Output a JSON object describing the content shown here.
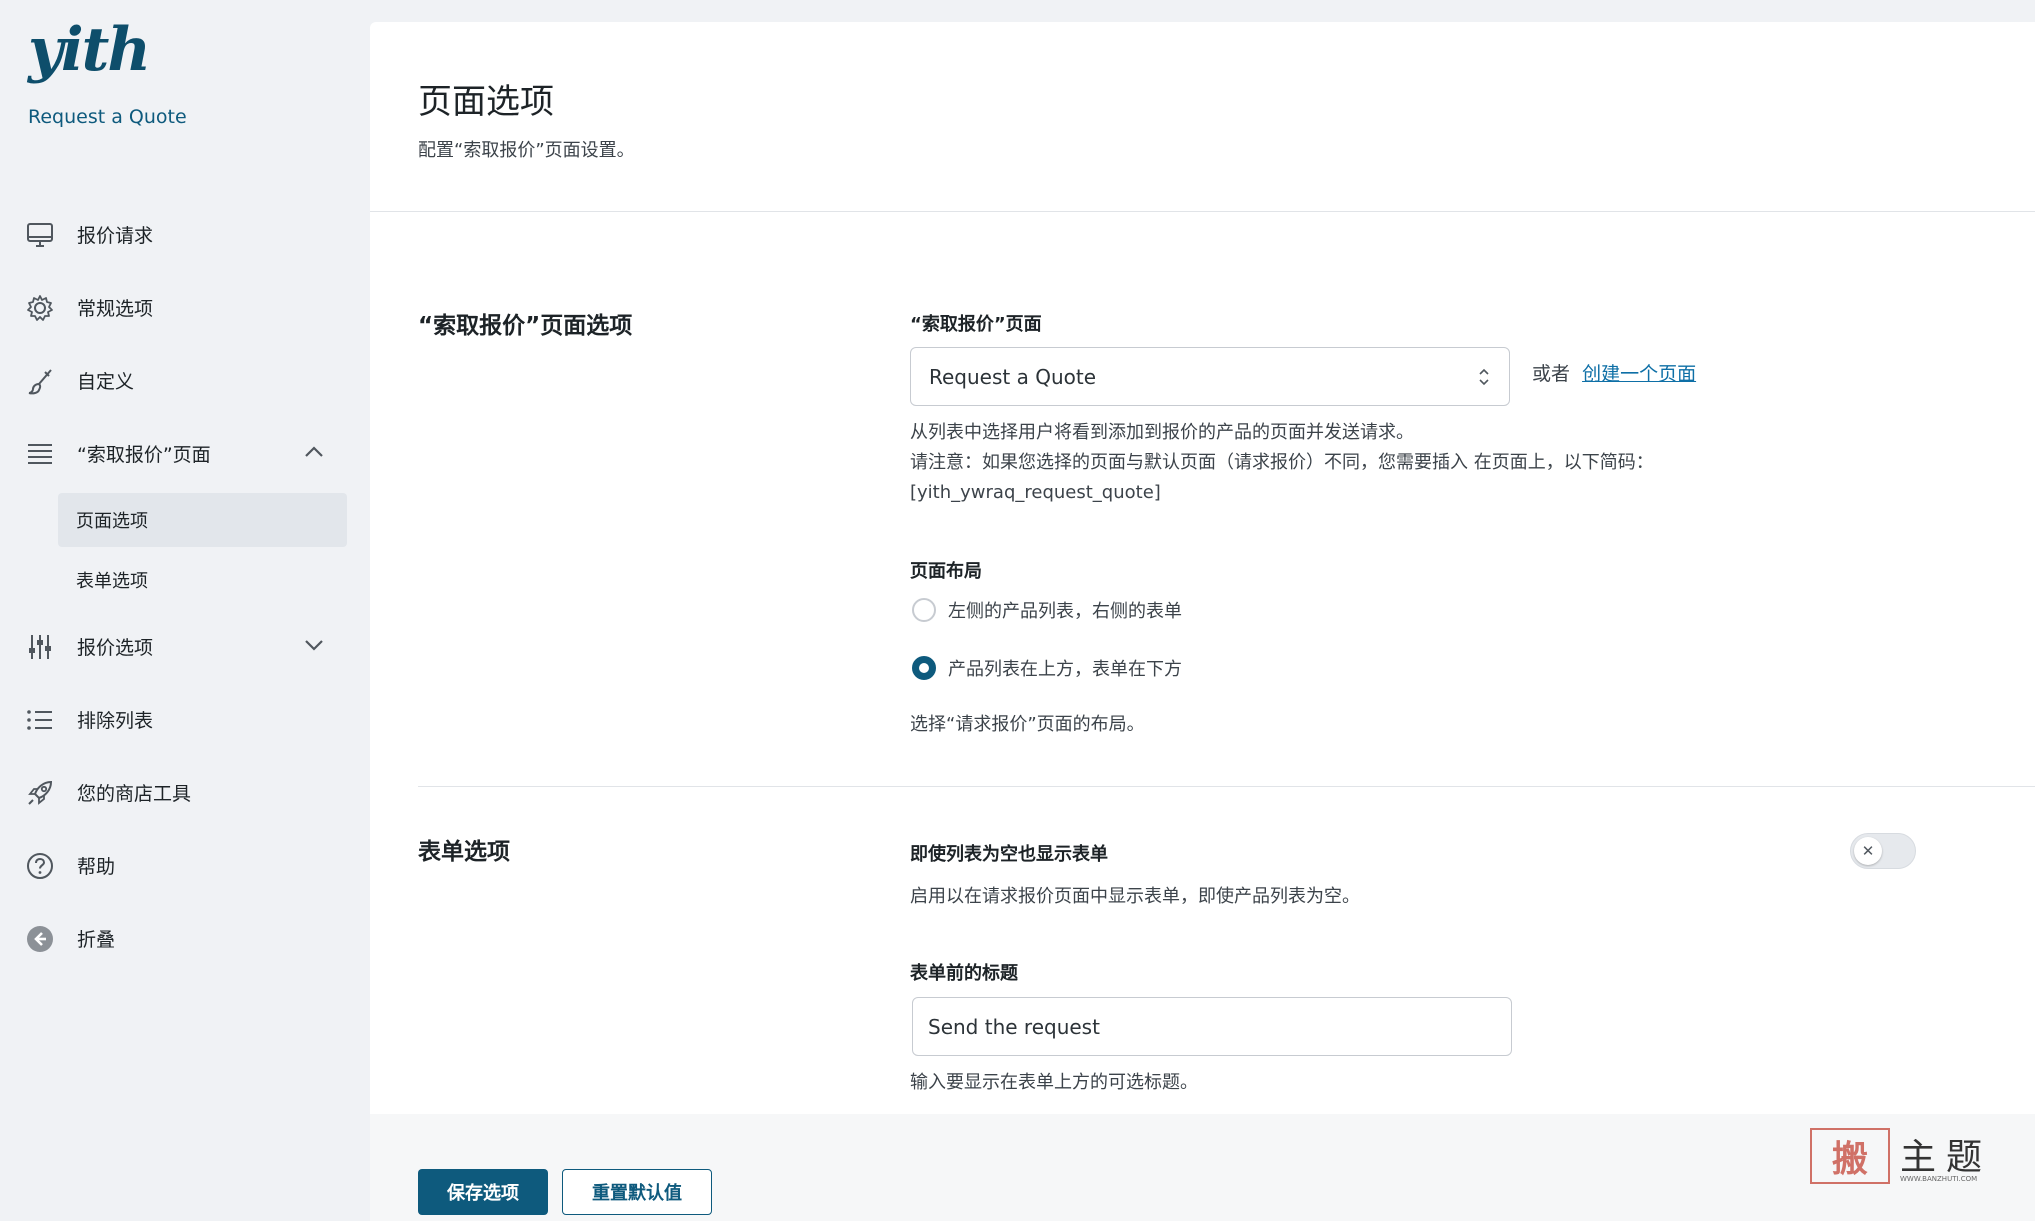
{
  "brand": {
    "logo_text": "yith",
    "plugin_name": "Request a Quote"
  },
  "sidebar": {
    "items": [
      {
        "label": "报价请求",
        "icon": "monitor-icon"
      },
      {
        "label": "常规选项",
        "icon": "gear-icon"
      },
      {
        "label": "自定义",
        "icon": "brush-icon"
      },
      {
        "label": "“索取报价”页面",
        "icon": "list-icon",
        "expanded": true
      },
      {
        "label": "报价选项",
        "icon": "sliders-icon",
        "expanded": false
      },
      {
        "label": "排除列表",
        "icon": "bullet-list-icon"
      },
      {
        "label": "您的商店工具",
        "icon": "rocket-icon"
      },
      {
        "label": "帮助",
        "icon": "help-icon"
      },
      {
        "label": "折叠",
        "icon": "collapse-icon"
      }
    ],
    "subitems": [
      {
        "label": "页面选项",
        "active": true
      },
      {
        "label": "表单选项",
        "active": false
      }
    ]
  },
  "page": {
    "title": "页面选项",
    "description": "配置“索取报价”页面设置。"
  },
  "sections": {
    "page_options": {
      "title": "“索取报价”页面选项",
      "quote_page_label": "“索取报价”页面",
      "quote_page_value": "Request a Quote",
      "or_text": "或者",
      "create_link": "创建一个页面",
      "help_line1": "从列表中选择用户将看到添加到报价的产品的页面并发送请求。",
      "help_line2": "请注意：如果您选择的页面与默认页面（请求报价）不同，您需要插入 在页面上，以下简码：",
      "help_line3": "[yith_ywraq_request_quote]",
      "layout_label": "页面布局",
      "layout_options": [
        {
          "label": "左侧的产品列表，右侧的表单",
          "checked": false
        },
        {
          "label": "产品列表在上方，表单在下方",
          "checked": true
        }
      ],
      "layout_help": "选择“请求报价”页面的布局。"
    },
    "form_options": {
      "title": "表单选项",
      "show_form_label": "即使列表为空也显示表单",
      "show_form_help": "启用以在请求报价页面中显示表单，即使产品列表为空。",
      "show_form_enabled": false,
      "form_title_label": "表单前的标题",
      "form_title_value": "Send the request",
      "form_title_help": "输入要显示在表单上方的可选标题。"
    }
  },
  "footer": {
    "save_label": "保存选项",
    "reset_label": "重置默认值"
  },
  "watermark": {
    "stamp": "搬",
    "text": "主题",
    "url": "WWW.BANZHUTI.COM"
  },
  "colors": {
    "accent": "#0e5a7d",
    "link": "#0e6fa6",
    "background": "#f0f2f5"
  }
}
